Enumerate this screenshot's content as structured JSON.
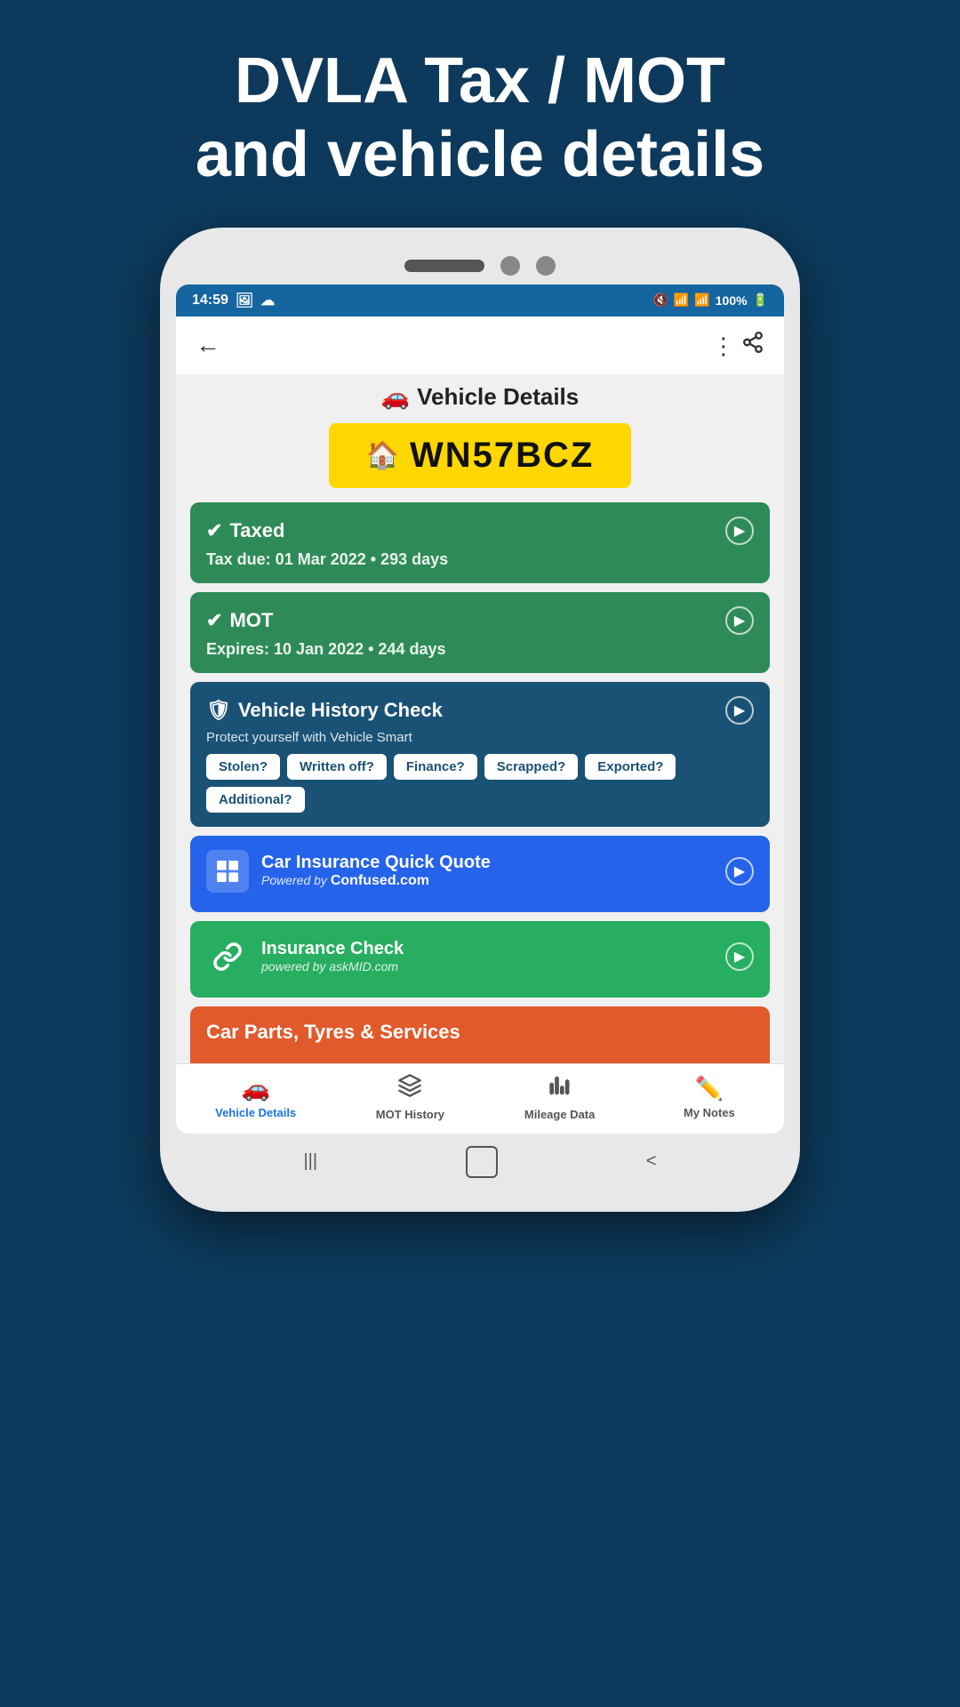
{
  "header": {
    "title_line1": "DVLA Tax / MOT",
    "title_line2": "and vehicle details"
  },
  "status_bar": {
    "time": "14:59",
    "battery": "100%"
  },
  "top_bar": {
    "back_label": "←",
    "share_label": "⋮"
  },
  "vehicle_heading": "Vehicle Details",
  "vehicle_heading_icon": "🚗",
  "license_plate": {
    "icon": "🏠",
    "number": "WN57BCZ"
  },
  "taxed_card": {
    "title": "Taxed",
    "subtitle": "Tax due: 01 Mar 2022 • 293 days"
  },
  "mot_card": {
    "title": "MOT",
    "subtitle": "Expires: 10 Jan 2022 • 244 days"
  },
  "history_check_card": {
    "title": "Vehicle History Check",
    "description": "Protect yourself with Vehicle Smart",
    "badges": [
      "Stolen?",
      "Written off?",
      "Finance?",
      "Scrapped?",
      "Exported?",
      "Additional?"
    ]
  },
  "insurance_quote_card": {
    "title": "Car Insurance Quick Quote",
    "subtitle_prefix": "Powered by",
    "brand": "Confused.com"
  },
  "insurance_check_card": {
    "title": "Insurance Check",
    "subtitle": "powered by askMID.com"
  },
  "partial_card": {
    "title": "Car Parts, Tyres & Services"
  },
  "bottom_nav": {
    "items": [
      {
        "label": "Vehicle Details",
        "icon": "🚗",
        "active": true
      },
      {
        "label": "MOT History",
        "icon": "⚠",
        "active": false
      },
      {
        "label": "Mileage Data",
        "icon": "📊",
        "active": false
      },
      {
        "label": "My Notes",
        "icon": "✏️",
        "active": false
      }
    ]
  }
}
